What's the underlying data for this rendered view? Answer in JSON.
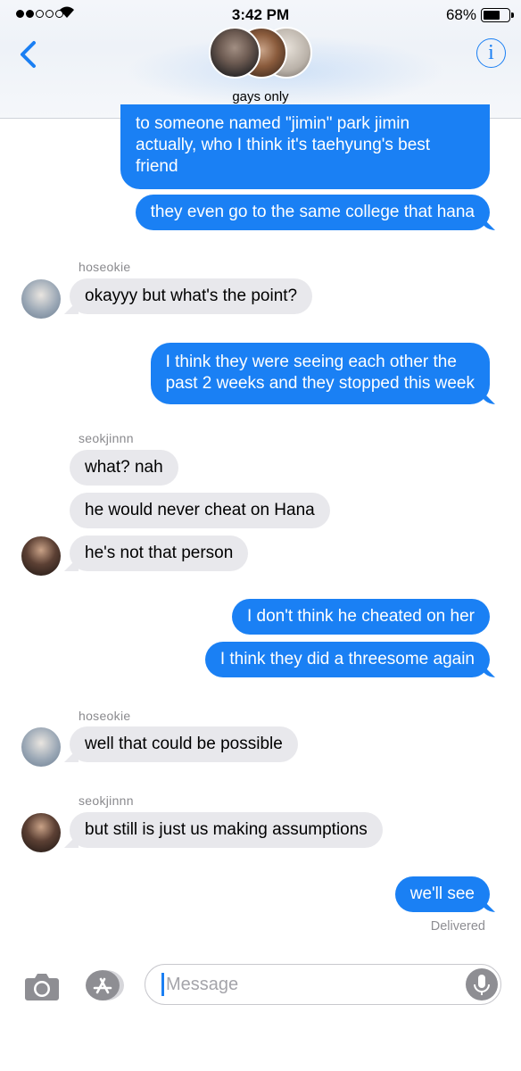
{
  "status_bar": {
    "time": "3:42 PM",
    "battery": "68%",
    "battery_level": 0.68,
    "signal_bars": 2
  },
  "header": {
    "group_name": "gays only",
    "info_label": "i"
  },
  "messages": {
    "m1": "to someone named \"jimin\" park jimin",
    "m1b": "actually, who I think it's taehyung's best",
    "m1c": "friend",
    "m2": "they even go to the same college that hana",
    "sender1": "hoseokie",
    "m3": "okayyy but what's the point?",
    "m4a": "I think they were seeing each other the",
    "m4b": "past 2 weeks and they stopped this week",
    "sender2": "seokjinnn",
    "m5": "what? nah",
    "m6": "he would never cheat on Hana",
    "m7": "he's not that person",
    "m8": "I don't think he cheated on her",
    "m9": "I think they did a threesome again",
    "sender3": "hoseokie",
    "m10": "well that could be possible",
    "sender4": "seokjinnn",
    "m11": "but still is just us making assumptions",
    "m12": "we'll see",
    "delivered": "Delivered"
  },
  "input": {
    "placeholder": "Message"
  },
  "colors": {
    "outgoing": "#1a80f4",
    "incoming": "#e8e8ec",
    "accent": "#1a7ff3"
  },
  "icons": [
    "back-chevron-icon",
    "info-icon",
    "camera-icon",
    "app-store-icon",
    "microphone-icon",
    "wifi-icon"
  ]
}
